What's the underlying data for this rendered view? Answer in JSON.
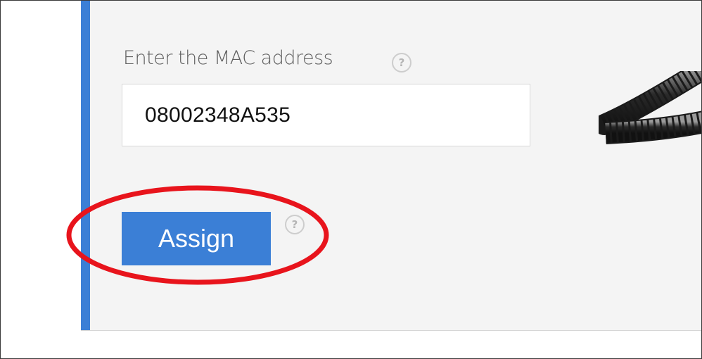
{
  "form": {
    "mac_label": "Enter the MAC address",
    "mac_value": "08002348A535",
    "help_glyph": "?",
    "assign_label": "Assign"
  },
  "icons": {
    "help": "question-circle-icon",
    "annotation": "red-ellipse-highlight",
    "image": "phone-coiled-cord"
  },
  "colors": {
    "accent": "#3b7fd6",
    "panel_bg": "#f4f4f4",
    "annotation": "#e8141c",
    "button_text": "#ffffff"
  }
}
